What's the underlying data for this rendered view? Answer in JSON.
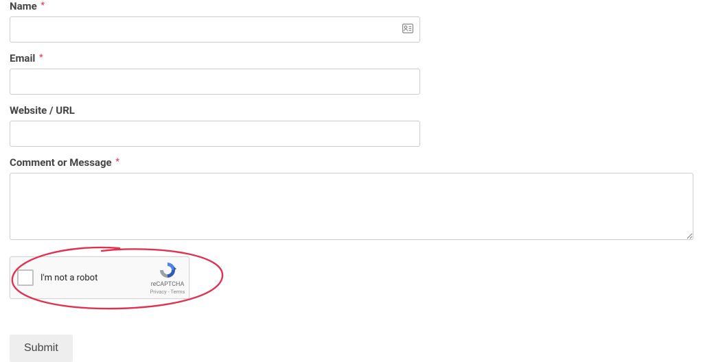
{
  "form": {
    "required_mark": "*",
    "name": {
      "label": "Name",
      "required": true,
      "value": ""
    },
    "email": {
      "label": "Email",
      "required": true,
      "value": ""
    },
    "website": {
      "label": "Website / URL",
      "required": false,
      "value": ""
    },
    "comment": {
      "label": "Comment or Message",
      "required": true,
      "value": ""
    },
    "captcha": {
      "label": "I'm not a robot",
      "brand": "reCAPTCHA",
      "privacy_label": "Privacy",
      "terms_label": "Terms",
      "separator": " - "
    },
    "submit_label": "Submit"
  }
}
